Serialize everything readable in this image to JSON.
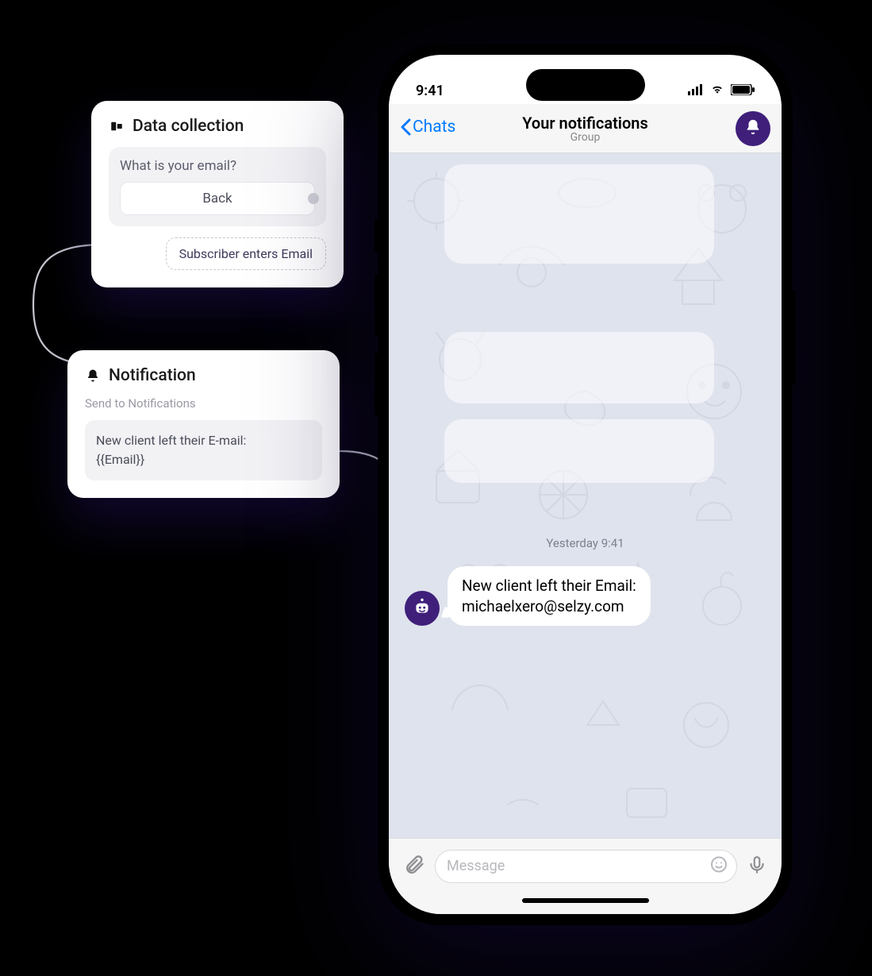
{
  "flow": {
    "data_collection": {
      "title": "Data collection",
      "question": "What is your email?",
      "back_label": "Back",
      "pill_label": "Subscriber enters Email"
    },
    "notification": {
      "title": "Notification",
      "subtitle": "Send to Notifications",
      "body_line1": "New client left their E-mail:",
      "body_line2": "{{Email}}"
    }
  },
  "phone": {
    "status": {
      "time": "9:41"
    },
    "nav": {
      "back_label": "Chats",
      "title": "Your notifications",
      "subtitle": "Group"
    },
    "chat": {
      "daystamp": "Yesterday 9:41",
      "message_line1": "New client left their Email:",
      "message_line2": "michaelxero@selzy.com"
    },
    "input": {
      "placeholder": "Message"
    }
  }
}
